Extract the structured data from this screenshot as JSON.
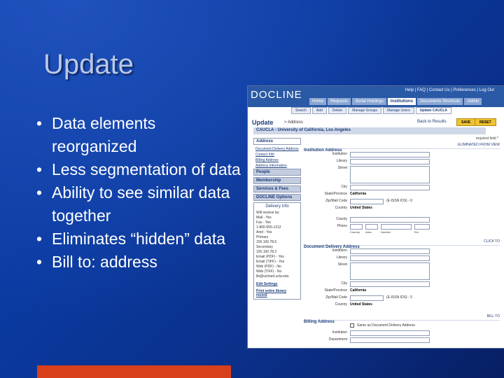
{
  "slide": {
    "title": "Update",
    "bullets": [
      "Data elements reorganized",
      "Less segmentation of data",
      "Ability to see similar data together",
      "Eliminates “hidden” data",
      "Bill to: address"
    ]
  },
  "screenshot": {
    "logo": "DOCLINE",
    "top_links": "Help | FAQ | Contact Us | Preferences | Log Out",
    "nav_tabs": [
      "Home",
      "Requests",
      "Serial Holdings",
      "Institutions",
      "Documents Shortcuts",
      "Admin"
    ],
    "active_nav": "Institutions",
    "sub_tabs": [
      "Search",
      "Add",
      "Delete",
      "Manage Groups",
      "Manage Users",
      "Update CAUCLA"
    ],
    "active_sub": "Update CAUCLA",
    "page_heading": "Update",
    "breadcrumb": "> Address",
    "back_link": "Back to Results",
    "save_label": "SAVE",
    "reset_label": "RESET",
    "required_note": "required field *",
    "institution_name": "CAUCLA - University of California, Los Angeles",
    "sidebar": {
      "items": [
        "Address"
      ],
      "links": [
        "Document Delivery Address",
        "Contact Info",
        "Billing Address",
        "Address Information"
      ],
      "items2": [
        "People",
        "Membership",
        "Services & Fees",
        "DOCLINE Options"
      ],
      "delivery_heading": "Delivery Info",
      "delivery_lines": [
        "Will receive by:",
        "Mail - Yes",
        "Fax - Yes",
        "1-800-555-1212",
        "Ariel - Yes",
        "Primary",
        "155.100.78.5",
        "Secondary",
        "155.100.78.2",
        "Email (PDF) - Yes",
        "Email (TIFF) - Yes",
        "Web (PDF) - No",
        "Web (TIFF) - No",
        "lib@uclmed.ucla.edu"
      ],
      "edit_link": "Edit Settings",
      "print_link": "Print entire library record"
    },
    "institution_address": {
      "heading": "Institution Address",
      "right_note": "ELIMINATED FROM VIEW",
      "fields": [
        "Institution",
        "Library",
        "Street",
        "City",
        "State/Province",
        "Zip/Mail Code",
        "Country"
      ],
      "state_value": "California",
      "zip_extra": "(E-ISSN IDS) - 0",
      "country_value": "United States",
      "county_label": "County",
      "phone_label": "Phone",
      "phone_captions": [
        "Country",
        "Area",
        "Number",
        "Ext."
      ]
    },
    "document_delivery": {
      "heading": "Document Delivery Address",
      "right_note": "CLICK TO",
      "fields": [
        "Institution",
        "Library",
        "Street",
        "City",
        "State/Province",
        "Zip/Mail Code",
        "Country"
      ],
      "state_value": "California",
      "zip_extra": "(E-ISSN IDS) - 0",
      "country_value": "United States"
    },
    "billing": {
      "heading": "Billing Address",
      "right_note": "BILL TO",
      "same_as_label": "Same as Document Delivery Address",
      "fields": [
        "Institution",
        "Department"
      ]
    }
  },
  "colors": {
    "background": "#0a3aa0",
    "title": "#b9c8e6",
    "accent_bar": "#d8401c",
    "screenshot_banner": "#2a59a6"
  }
}
